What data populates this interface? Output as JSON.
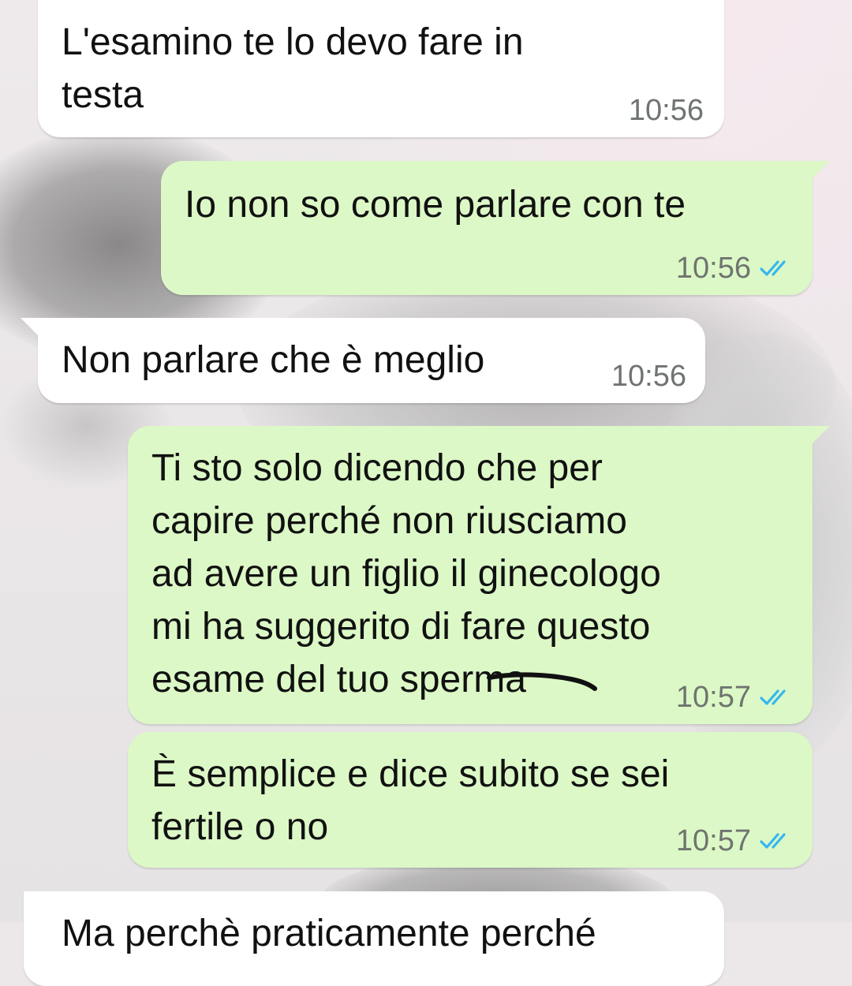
{
  "chat": {
    "messages": [
      {
        "direction": "incoming",
        "text": "L'esamino te lo devo fare in\ntesta",
        "time": "10:56"
      },
      {
        "direction": "outgoing",
        "text": "Io non so come parlare con te",
        "time": "10:56",
        "status": "read"
      },
      {
        "direction": "incoming",
        "text": "Non parlare che è meglio",
        "time": "10:56"
      },
      {
        "direction": "outgoing",
        "text": "Ti sto solo dicendo che per\ncapire perché non riusciamo\nad avere un figlio il ginecologo\nmi ha suggerito di fare questo\nesame del tuo sperma",
        "time": "10:57",
        "status": "read"
      },
      {
        "direction": "outgoing",
        "text": "È semplice e dice subito se sei\nfertile o no",
        "time": "10:57",
        "status": "read"
      },
      {
        "direction": "incoming",
        "text": "Ma perchè praticamente perché"
      }
    ]
  },
  "theme": {
    "incoming_bubble": "#ffffff",
    "outgoing_bubble": "#dcf8c6",
    "read_tick_color": "#34b7f1",
    "time_color": "#6f7470"
  },
  "icons": {
    "read_receipt": "double-check-icon"
  }
}
